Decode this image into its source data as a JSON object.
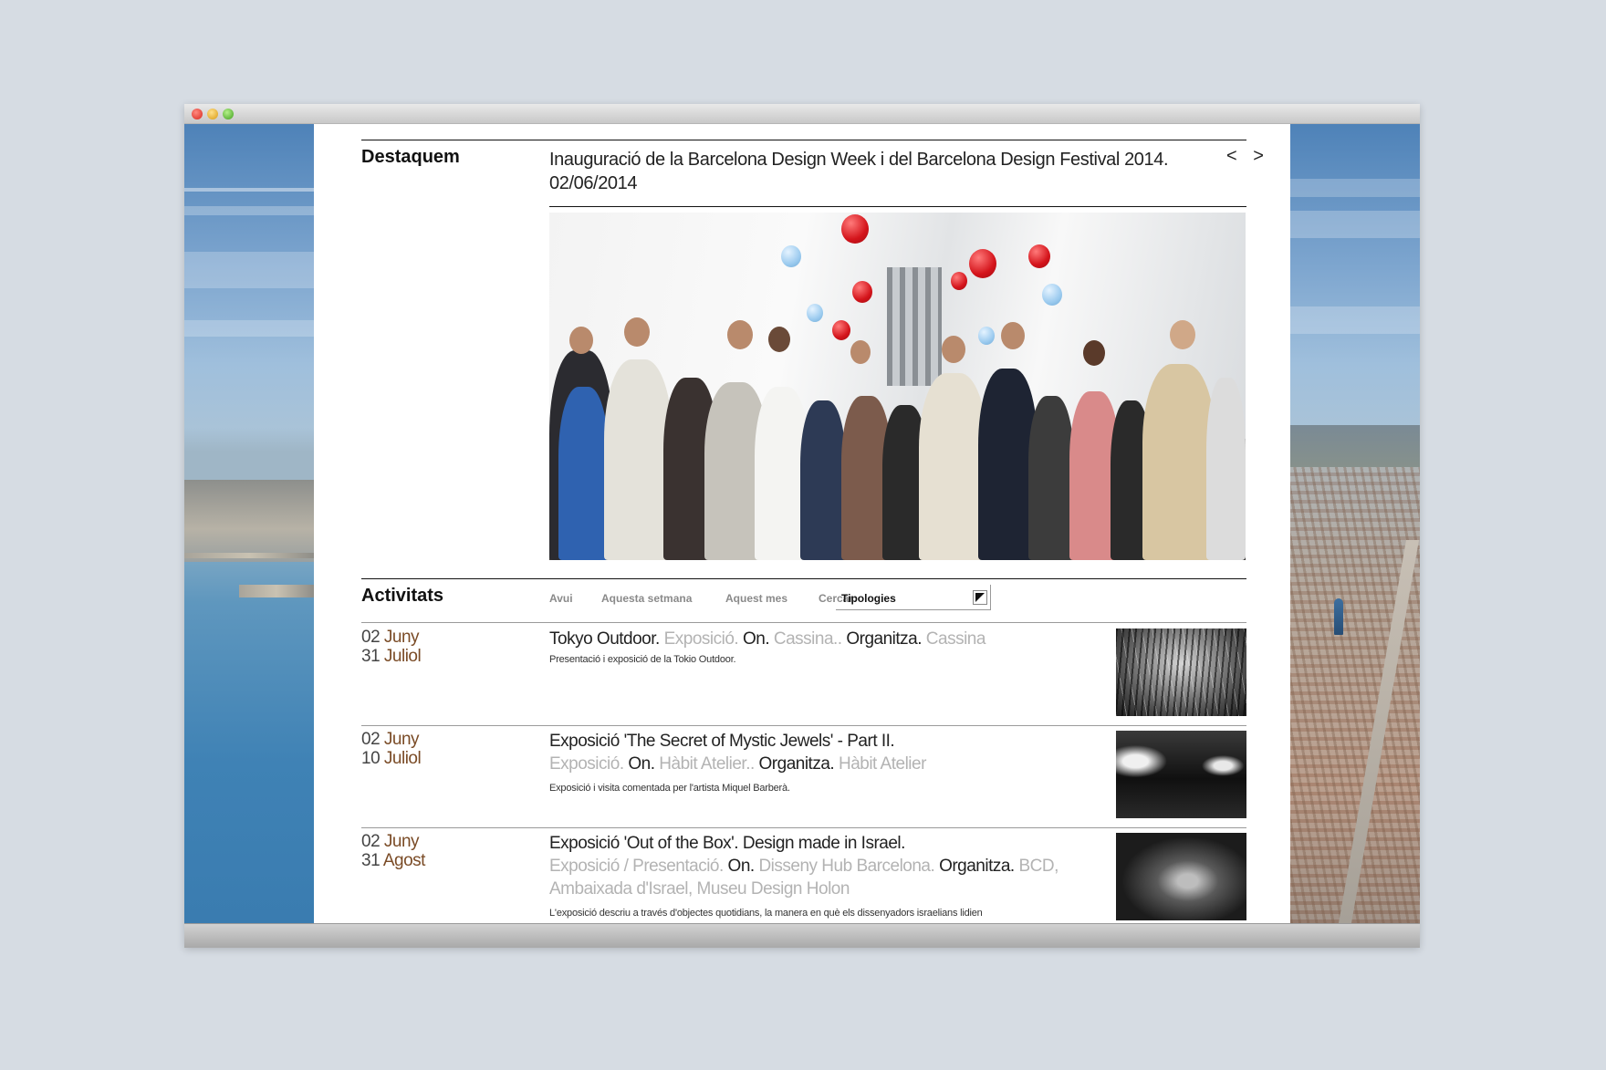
{
  "featured": {
    "section_label": "Destaquem",
    "title": "Inauguració de la Barcelona Design Week i del Barcelona Design Festival 2014.",
    "date": "02/06/2014",
    "nav_arrows": "< >"
  },
  "activities": {
    "section_label": "Activitats",
    "filters": {
      "today": "Avui",
      "this_week": "Aquesta setmana",
      "this_month": "Aquest mes",
      "search_label": "Cercar:",
      "typology_select": "Tipologies"
    },
    "items": [
      {
        "date_start_day": "02",
        "date_start_month": "Juny",
        "date_end_day": "31",
        "date_end_month": "Juliol",
        "title": "Tokyo Outdoor.",
        "type": "Exposició.",
        "on_label": "On.",
        "place": "Cassina..",
        "org_label": "Organitza.",
        "organizer": "Cassina",
        "description": "Presentació i exposició de la Tokio Outdoor."
      },
      {
        "date_start_day": "02",
        "date_start_month": "Juny",
        "date_end_day": "10",
        "date_end_month": "Juliol",
        "title": "Exposició 'The Secret of Mystic Jewels' - Part II.",
        "type": "Exposició.",
        "on_label": "On.",
        "place": "Hàbit Atelier..",
        "org_label": "Organitza.",
        "organizer": "Hàbit Atelier",
        "description": "Exposició i visita comentada per l'artista Miquel Barberà."
      },
      {
        "date_start_day": "02",
        "date_start_month": "Juny",
        "date_end_day": "31",
        "date_end_month": "Agost",
        "title": "Exposició 'Out of the Box'. Design made in Israel.",
        "type": "Exposició / Presentació.",
        "on_label": "On.",
        "place": "Disseny Hub Barcelona.",
        "org_label": "Organitza.",
        "organizer": "BCD, Ambaixada d'Israel, Museu Design Holon",
        "description": "L'exposició descriu a través d'objectes quotidians, la manera en què els dissenyadors israelians lidien"
      }
    ]
  }
}
